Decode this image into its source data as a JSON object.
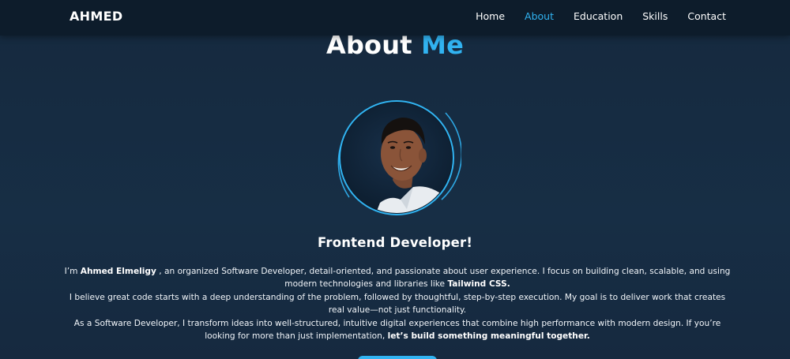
{
  "navbar": {
    "brand": "AHMED",
    "links": [
      {
        "label": "Home",
        "active": false
      },
      {
        "label": "About",
        "active": true
      },
      {
        "label": "Education",
        "active": false
      },
      {
        "label": "Skills",
        "active": false
      },
      {
        "label": "Contact",
        "active": false
      }
    ]
  },
  "about": {
    "title_main": "About",
    "title_accent": "Me",
    "role": "Frontend Developer!",
    "bio": {
      "p1_before": "I’m ",
      "p1_name": "Ahmed Elmeligy",
      "p1_after": " , an organized Software Developer, detail-oriented, and passionate about user experience. I focus on building clean, scalable, and using modern technologies and libraries like ",
      "p1_tech": "Tailwind CSS.",
      "p2": "I believe great code starts with a deep understanding of the problem, followed by thoughtful, step-by-step execution. My goal is to deliver work that creates real value—not just functionality.",
      "p3_before": "As a Software Developer, I transform ideas into well-structured, intuitive digital experiences that combine high performance with modern design. If you’re looking for more than just implementation, ",
      "p3_cta": "let’s build something meaningful together."
    }
  },
  "colors": {
    "accent": "#31b3f1",
    "navbar_bg": "#0d1c2b",
    "page_bg": "#172d44"
  }
}
